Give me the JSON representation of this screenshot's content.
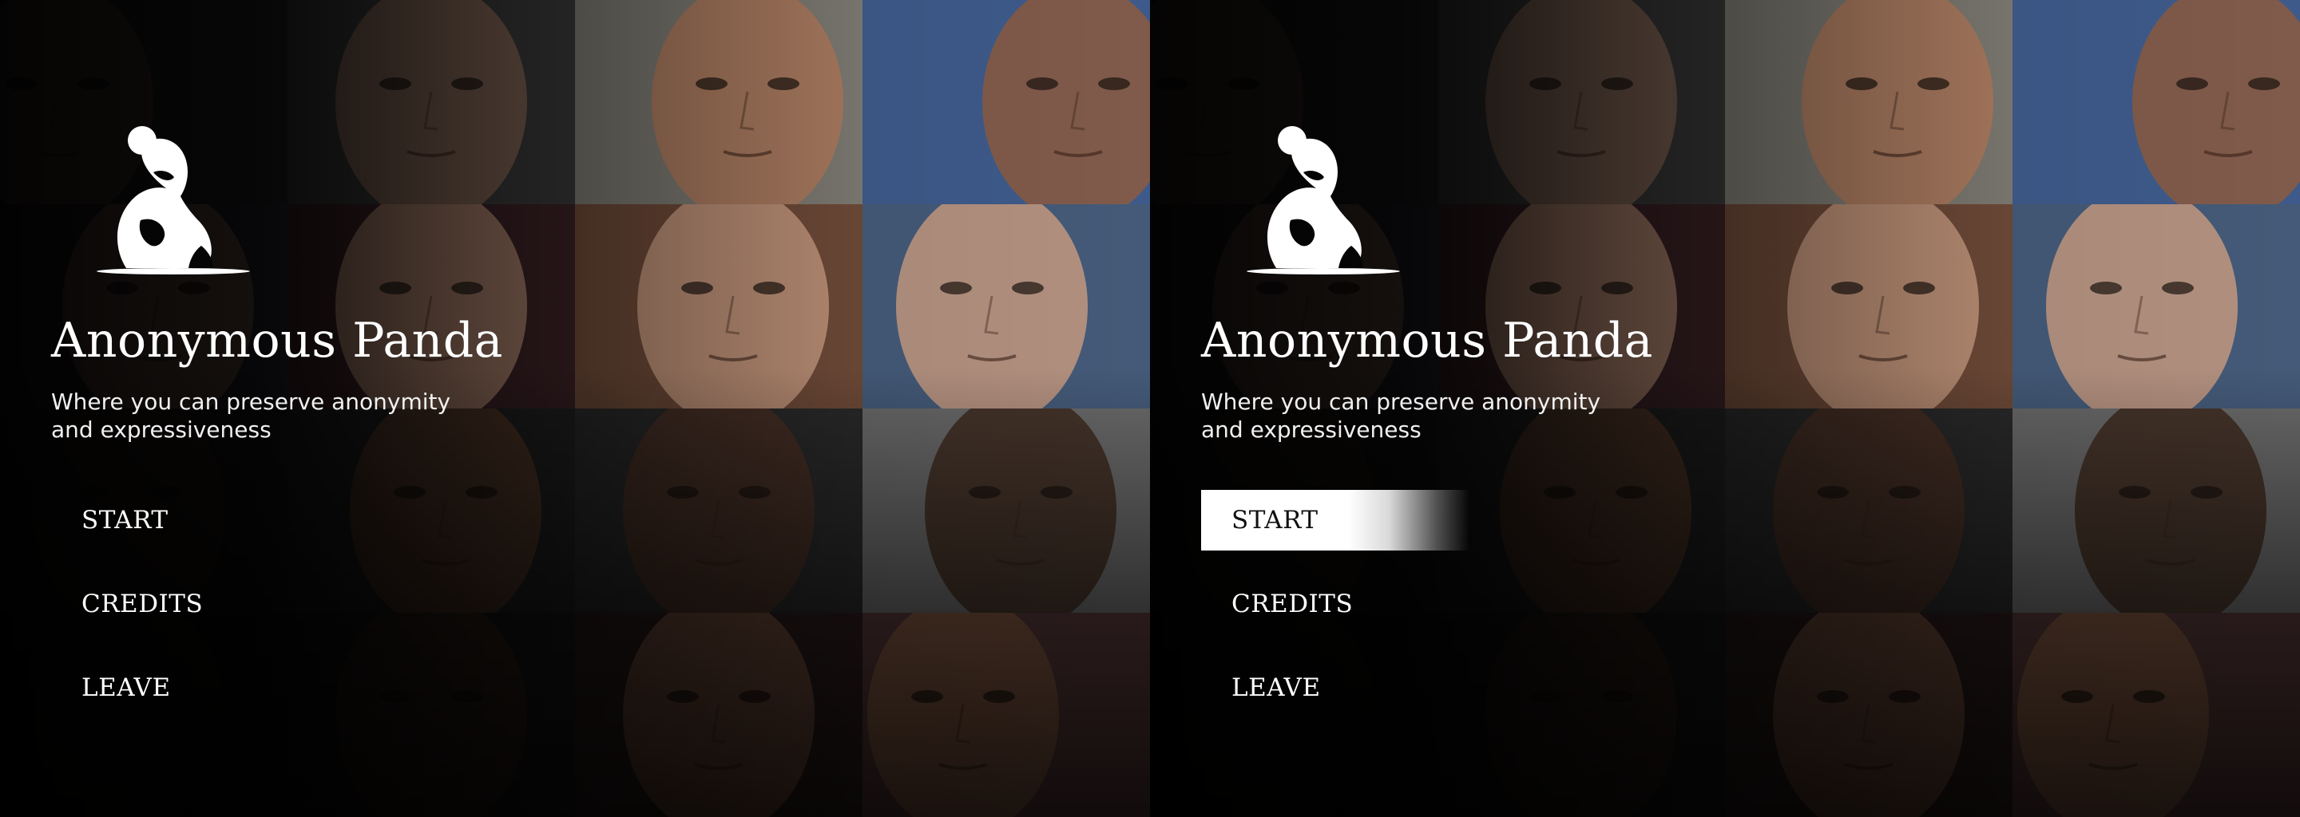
{
  "app": {
    "title": "Anonymous Panda",
    "tagline": "Where you can preserve anonymity and expressiveness",
    "logo_icon": "panda-logo-icon"
  },
  "screens": [
    {
      "state": "default",
      "menu": [
        {
          "label": "START",
          "selected": false
        },
        {
          "label": "CREDITS",
          "selected": false
        },
        {
          "label": "LEAVE",
          "selected": false
        }
      ]
    },
    {
      "state": "start-hovered",
      "menu": [
        {
          "label": "START",
          "selected": true
        },
        {
          "label": "CREDITS",
          "selected": false
        },
        {
          "label": "LEAVE",
          "selected": false
        }
      ]
    }
  ],
  "colors": {
    "background": "#050505",
    "text": "#ffffff",
    "selected_bg": "#ffffff",
    "selected_text": "#111111"
  },
  "background_faces": [
    "face-photo",
    "face-photo",
    "face-photo",
    "face-photo",
    "face-photo",
    "face-photo",
    "face-photo",
    "face-photo",
    "face-photo",
    "face-photo",
    "face-photo",
    "face-photo",
    "face-photo",
    "face-photo",
    "face-photo",
    "face-photo"
  ]
}
